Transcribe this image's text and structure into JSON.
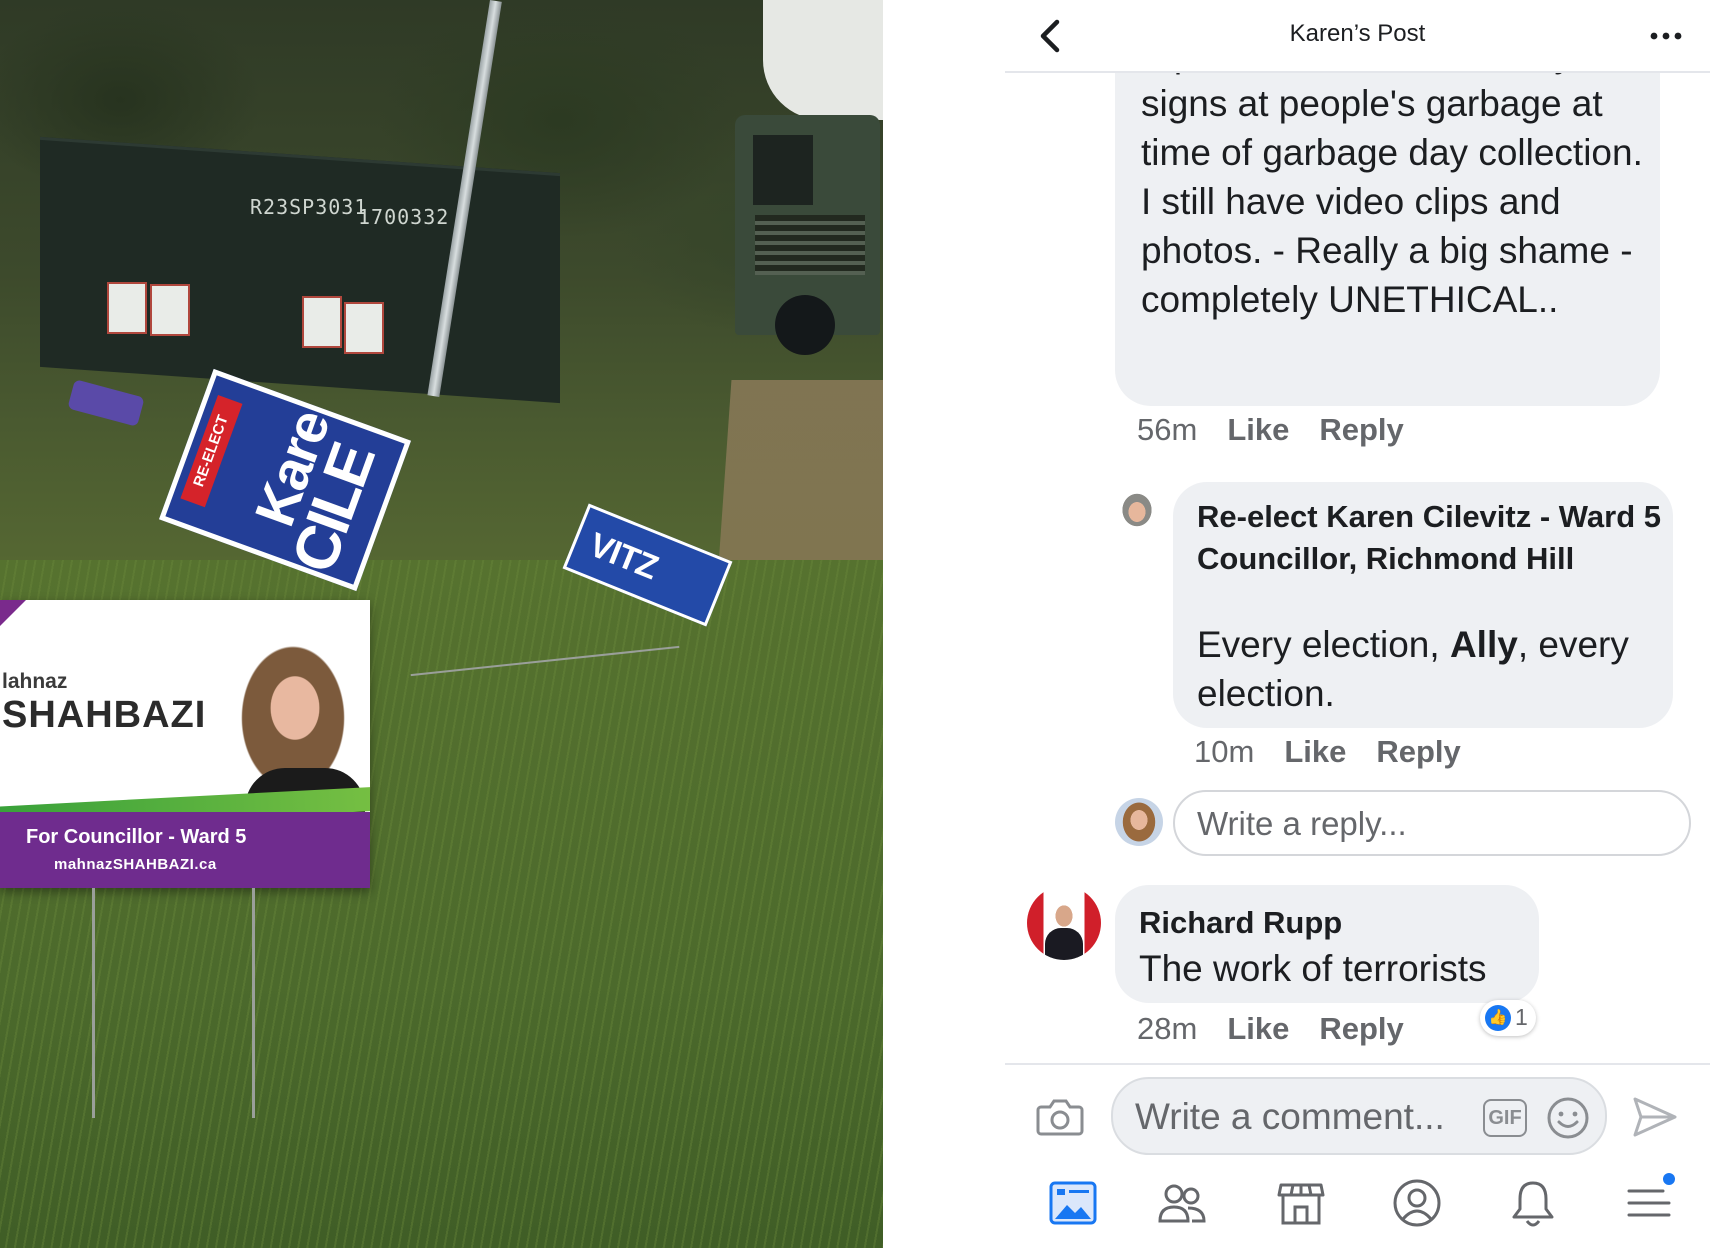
{
  "photo": {
    "box_label_1": "R23SP3031",
    "box_label_2": "1700332",
    "sign_blue": {
      "reelect": "RE-ELECT",
      "name1": "Karen",
      "name2": "CILE"
    },
    "sign_small": {
      "text": "VITZ"
    },
    "sign_purple": {
      "first_name": "lahnaz",
      "last_name": "SHAHBAZI",
      "tagline": "For Councillor - Ward 5",
      "website": "mahnazSHAHBAZI.ca"
    }
  },
  "header": {
    "title": "Karen’s Post"
  },
  "comments": [
    {
      "text": "report. I found some of my signs at people's garbage at time of garbage day collection. I still have video clips and photos. - Really a big shame - completely UNETHICAL..",
      "time": "56m",
      "like": "Like",
      "reply": "Reply"
    },
    {
      "author": "Re-elect Karen Cilevitz - Ward 5 Councillor, Richmond Hill",
      "text_before": "Every election, ",
      "text_bold": "Ally",
      "text_after": ", every election.",
      "time": "10m",
      "like": "Like",
      "reply": "Reply"
    },
    {
      "author": "Richard Rupp",
      "text": "The work of terrorists",
      "time": "28m",
      "like": "Like",
      "reply": "Reply",
      "reaction_count": "1"
    }
  ],
  "reply_input": {
    "placeholder": "Write a reply..."
  },
  "composer": {
    "placeholder": "Write a comment...",
    "gif_label": "GIF"
  },
  "tabs": [
    "news-feed",
    "friends",
    "marketplace",
    "profile",
    "notifications",
    "menu"
  ],
  "colors": {
    "accent": "#1877f2",
    "bubble": "#eef0f3",
    "muted_text": "#65676b"
  }
}
